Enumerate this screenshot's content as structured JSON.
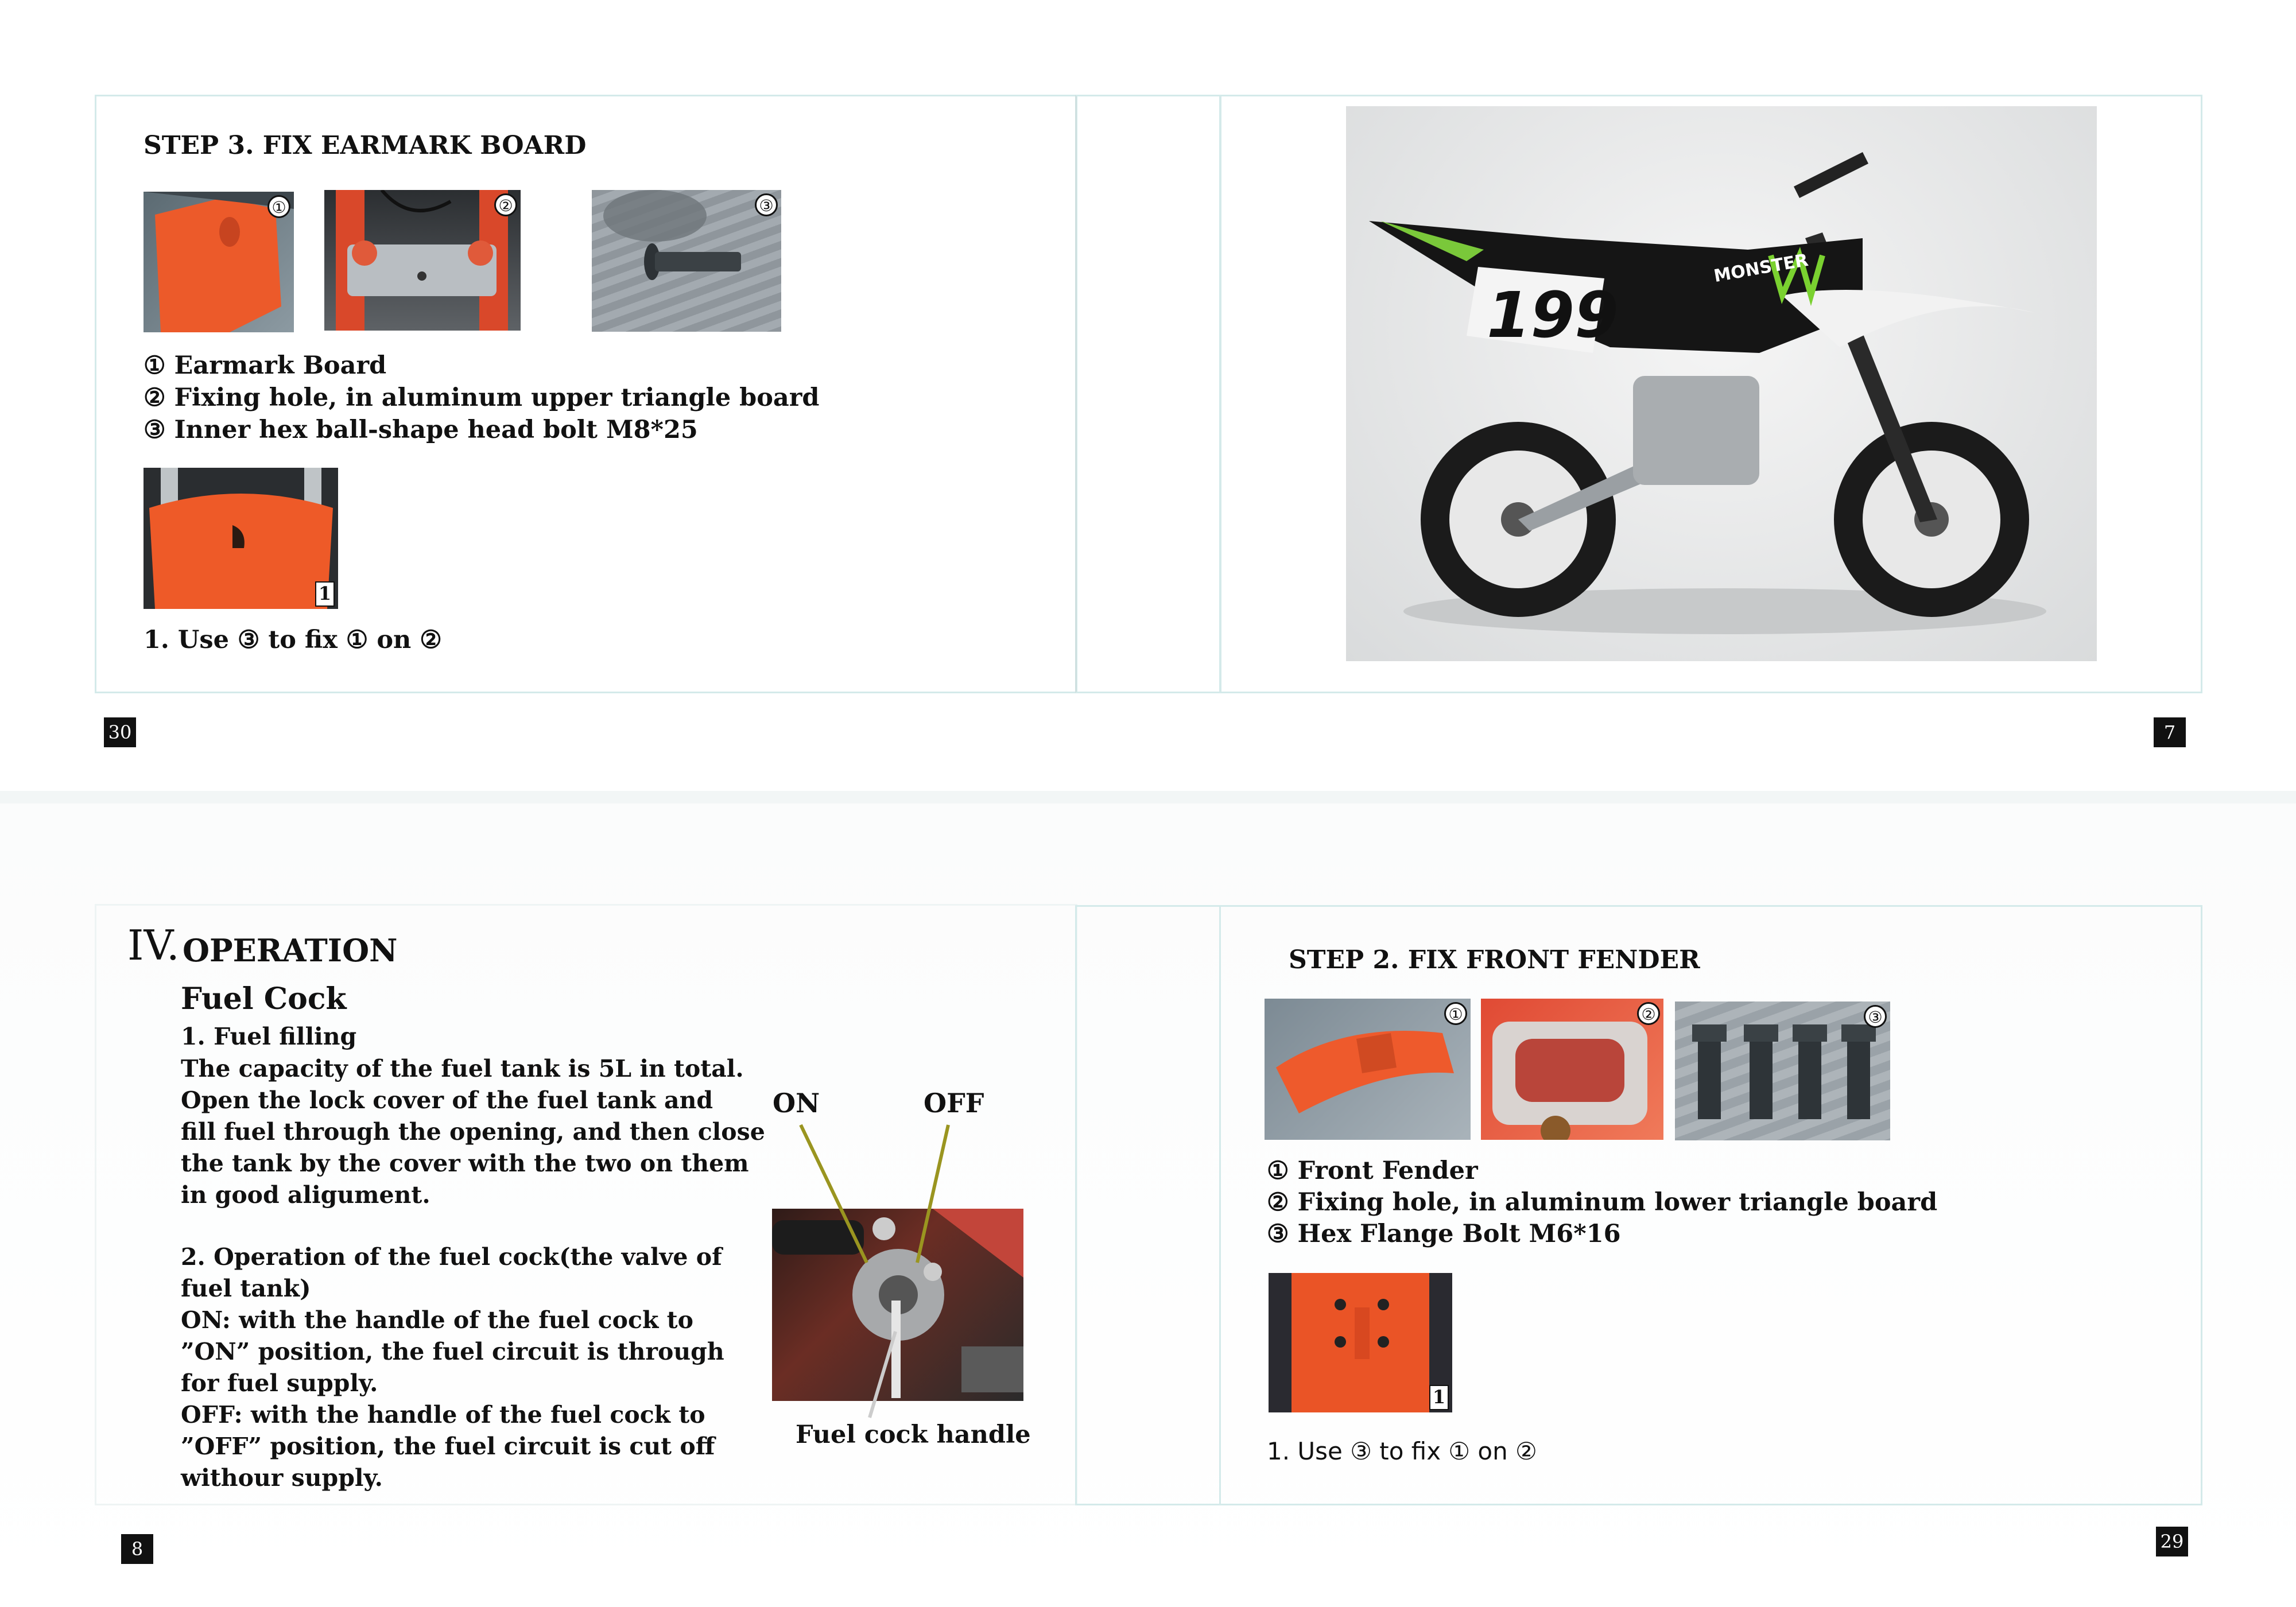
{
  "page30": {
    "title": "STEP 3. FIX EARMARK BOARD",
    "badges": [
      "①",
      "②",
      "③"
    ],
    "legend": [
      "① Earmark Board",
      "② Fixing hole, in aluminum upper triangle board",
      "③ Inner hex ball-shape head bolt M8*25"
    ],
    "detail_badge": "1",
    "instruction": "1. Use ③ to fix ① on ②",
    "page_number": "30"
  },
  "page7": {
    "page_number": "7",
    "bike_number": "199",
    "brand_text": "MONSTER"
  },
  "page8": {
    "chapter_numeral": "IV.",
    "chapter_title": "OPERATION",
    "section": "Fuel Cock",
    "sub1": "1. Fuel filling",
    "para1": [
      "The capacity of the fuel tank is 5L in total.",
      "Open the lock cover of the fuel tank and",
      "fill fuel through the opening, and then close",
      "the tank by the cover with the two on them",
      "in good aligument."
    ],
    "sub2": [
      "2. Operation of the fuel cock(the valve of",
      "fuel tank)"
    ],
    "para2": [
      "ON: with the handle of the fuel cock to",
      "”ON” position, the fuel circuit is through",
      "for fuel supply.",
      "OFF: with the handle of the fuel cock to",
      "”OFF” position, the fuel circuit is cut off",
      "withour supply."
    ],
    "label_on": "ON",
    "label_off": "OFF",
    "caption": "Fuel cock handle",
    "page_number": "8"
  },
  "page29": {
    "title": "STEP 2. FIX FRONT FENDER",
    "badges": [
      "①",
      "②",
      "③"
    ],
    "legend": [
      "① Front Fender",
      "② Fixing hole, in aluminum lower triangle board",
      "③ Hex Flange Bolt M6*16"
    ],
    "detail_badge": "1",
    "instruction": "1. Use ③ to fix ① on ②",
    "page_number": "29"
  },
  "colors": {
    "accent_orange": "#e8552b",
    "frame": "#d4eaea",
    "pointer_line": "#9a9520"
  }
}
